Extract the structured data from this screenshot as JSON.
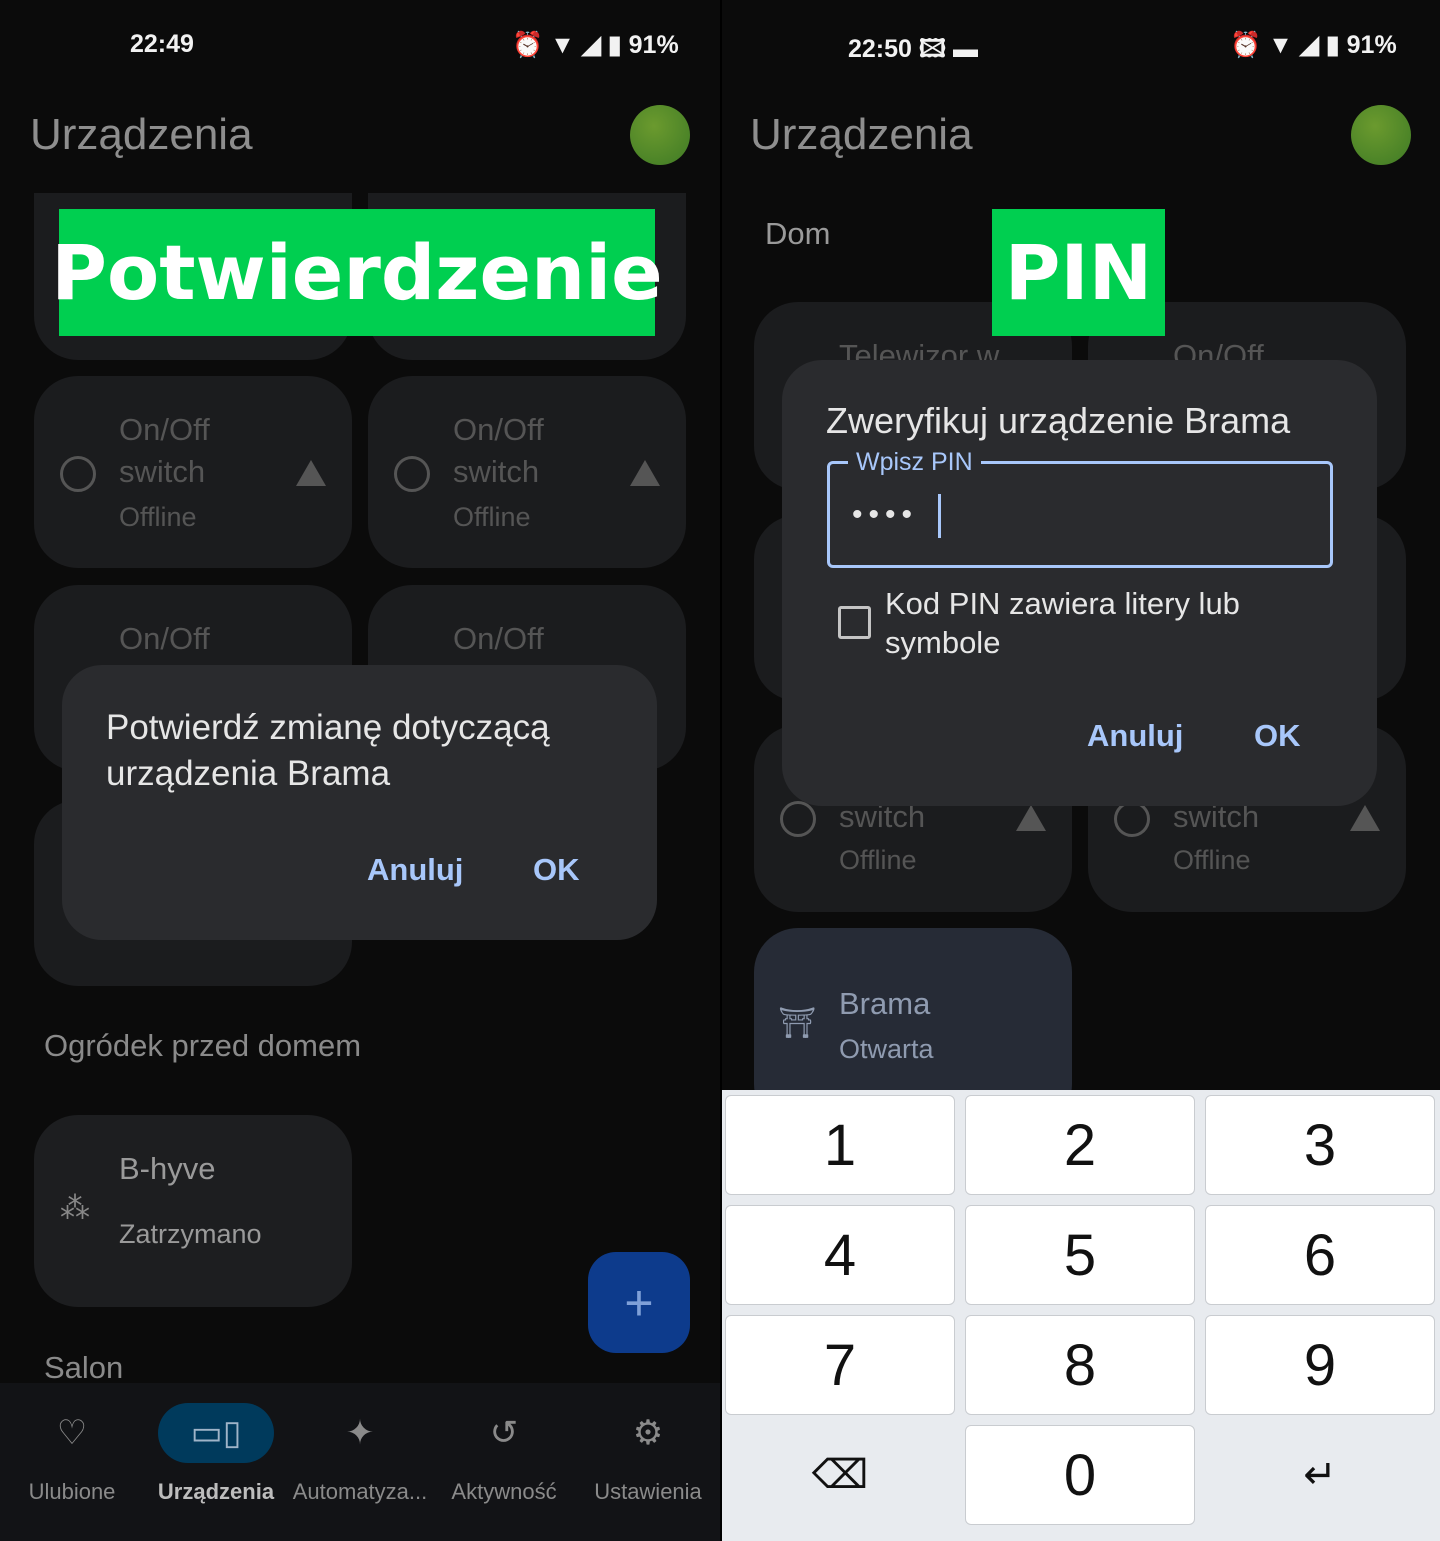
{
  "left": {
    "status": {
      "time": "22:49",
      "battery": "91%"
    },
    "title": "Urządzenia",
    "overlay_label": "Potwierdzenie",
    "cards": [
      {
        "line1": "On/Off",
        "line2": "switch",
        "line3": "Offline"
      },
      {
        "line1": "On/Off",
        "line2": "switch",
        "line3": "Offline"
      },
      {
        "line1": "On/Off"
      },
      {
        "line1": "On/Off"
      }
    ],
    "section_garden": "Ogródek przed domem",
    "bhyve": {
      "name": "B-hyve",
      "state": "Zatrzymano"
    },
    "section_salon": "Salon",
    "fab_icon": "plus-icon",
    "dialog": {
      "text": "Potwierdź zmianę dotyczącą urządzenia Brama",
      "cancel": "Anuluj",
      "ok": "OK"
    },
    "nav": [
      {
        "label": "Ulubione",
        "icon": "heart-icon"
      },
      {
        "label": "Urządzenia",
        "icon": "devices-icon",
        "active": true
      },
      {
        "label": "Automatyza...",
        "icon": "sparkle-icon"
      },
      {
        "label": "Aktywność",
        "icon": "history-icon"
      },
      {
        "label": "Ustawienia",
        "icon": "gear-icon"
      }
    ]
  },
  "right": {
    "status": {
      "time": "22:50",
      "battery": "91%"
    },
    "title": "Urządzenia",
    "section": "Dom",
    "overlay_label": "PIN",
    "cards": [
      {
        "line1": "Telewizor w"
      },
      {
        "line1": "On/Off"
      },
      {
        "line2": "switch",
        "line3": "Offline"
      },
      {
        "line2": "switch",
        "line3": "Offline"
      }
    ],
    "brama": {
      "name": "Brama",
      "state": "Otwarta"
    },
    "dialog": {
      "title": "Zweryfikuj urządzenie Brama",
      "field_label": "Wpisz PIN",
      "field_value": "••••",
      "checkbox_label": "Kod PIN zawiera litery lub symbole",
      "checkbox_checked": false,
      "cancel": "Anuluj",
      "ok": "OK"
    },
    "keyboard": [
      "1",
      "2",
      "3",
      "4",
      "5",
      "6",
      "7",
      "8",
      "9",
      "⌫",
      "0",
      "↵"
    ]
  },
  "colors": {
    "accent": "#a8c7fa",
    "label_green": "#00cf50",
    "fab": "#0d3b8c",
    "nav_active": "#003a5c"
  }
}
